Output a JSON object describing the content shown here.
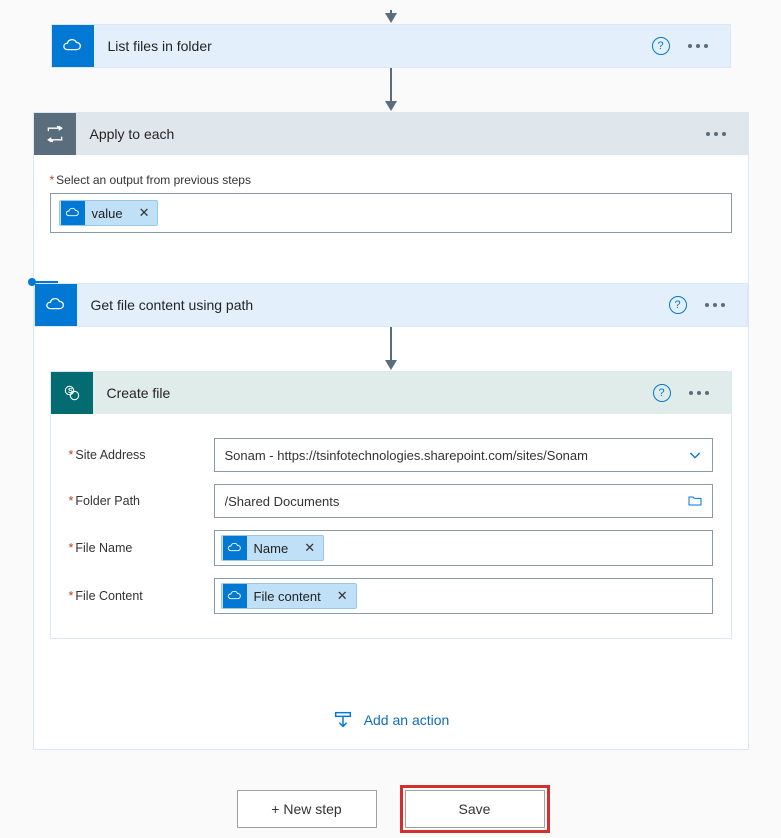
{
  "steps": {
    "list_files": {
      "title": "List files in folder"
    },
    "apply_each": {
      "title": "Apply to each",
      "output_label": "Select an output from previous steps",
      "output_token": "value"
    },
    "get_content": {
      "title": "Get file content using path"
    },
    "create_file": {
      "title": "Create file",
      "fields": {
        "site_address": {
          "label": "Site Address",
          "value": "Sonam - https://tsinfotechnologies.sharepoint.com/sites/Sonam"
        },
        "folder_path": {
          "label": "Folder Path",
          "value": "/Shared Documents"
        },
        "file_name": {
          "label": "File Name",
          "token": "Name"
        },
        "file_content": {
          "label": "File Content",
          "token": "File content"
        }
      }
    }
  },
  "actions": {
    "add_action": "Add an action",
    "new_step": "+ New step",
    "save": "Save"
  }
}
